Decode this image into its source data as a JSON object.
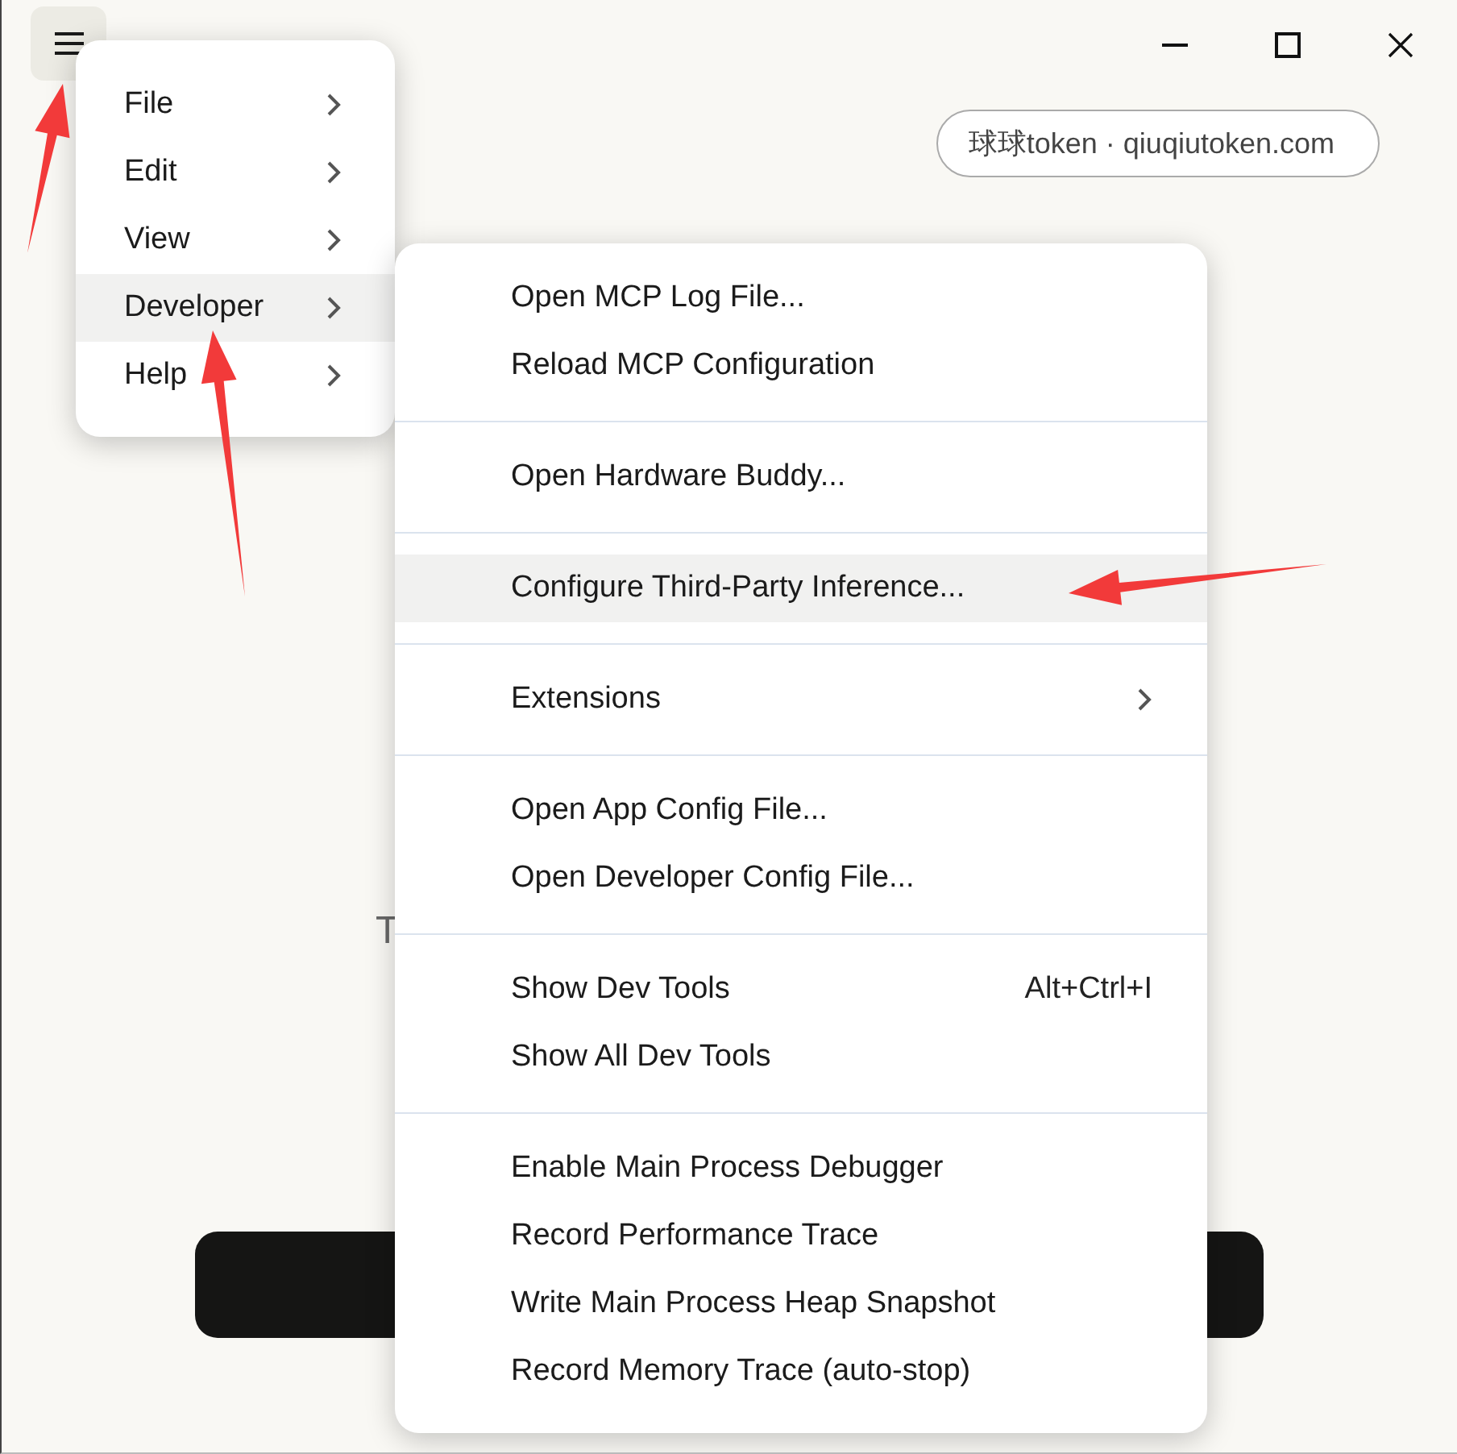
{
  "account_pill": {
    "text": "球球token · qiuqiutoken.com"
  },
  "background": {
    "subtitle": "T"
  },
  "menu": {
    "items": [
      {
        "label": "File",
        "selected": false,
        "has_submenu": true
      },
      {
        "label": "Edit",
        "selected": false,
        "has_submenu": true
      },
      {
        "label": "View",
        "selected": false,
        "has_submenu": true
      },
      {
        "label": "Developer",
        "selected": true,
        "has_submenu": true
      },
      {
        "label": "Help",
        "selected": false,
        "has_submenu": true
      }
    ]
  },
  "submenu": {
    "groups": [
      {
        "items": [
          {
            "label": "Open MCP Log File...",
            "selected": false
          },
          {
            "label": "Reload MCP Configuration",
            "selected": false
          }
        ]
      },
      {
        "items": [
          {
            "label": "Open Hardware Buddy...",
            "selected": false
          }
        ]
      },
      {
        "items": [
          {
            "label": "Configure Third-Party Inference...",
            "selected": true
          }
        ]
      },
      {
        "items": [
          {
            "label": "Extensions",
            "selected": false,
            "has_submenu": true
          }
        ]
      },
      {
        "items": [
          {
            "label": "Open App Config File...",
            "selected": false
          },
          {
            "label": "Open Developer Config File...",
            "selected": false
          }
        ]
      },
      {
        "items": [
          {
            "label": "Show Dev Tools",
            "selected": false,
            "shortcut": "Alt+Ctrl+I"
          },
          {
            "label": "Show All Dev Tools",
            "selected": false
          }
        ]
      },
      {
        "items": [
          {
            "label": "Enable Main Process Debugger",
            "selected": false
          },
          {
            "label": "Record Performance Trace",
            "selected": false
          },
          {
            "label": "Write Main Process Heap Snapshot",
            "selected": false
          },
          {
            "label": "Record Memory Trace (auto-stop)",
            "selected": false
          }
        ]
      }
    ]
  }
}
